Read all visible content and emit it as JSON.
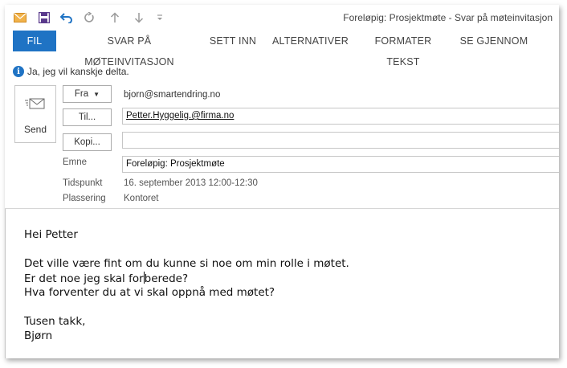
{
  "window": {
    "title": "Foreløpig: Prosjektmøte - Svar på møteinvitasjon"
  },
  "quick_access": {
    "icons": [
      "envelope-icon",
      "save-icon",
      "undo-icon",
      "redo-icon",
      "arrow-up-icon",
      "arrow-down-icon",
      "customize-icon"
    ]
  },
  "ribbon": {
    "tabs": [
      {
        "label": "FIL"
      },
      {
        "label": "SVAR PÅ MØTEINVITASJON"
      },
      {
        "label": "SETT INN"
      },
      {
        "label": "ALTERNATIVER"
      },
      {
        "label": "FORMATER TEKST"
      },
      {
        "label": "SE GJENNOM"
      }
    ]
  },
  "infobar": {
    "text": "Ja, jeg vil kanskje delta."
  },
  "compose": {
    "send_label": "Send",
    "from_button": "Fra",
    "from_address": "bjorn@smartendring.no",
    "to_button": "Til...",
    "to_value": "Petter.Hyggelig.@firma.no",
    "cc_button": "Kopi...",
    "cc_value": "",
    "subject_label": "Emne",
    "subject_value": "Foreløpig: Prosjektmøte",
    "time_label": "Tidspunkt",
    "time_value": "16. september 2013 12:00-12:30",
    "location_label": "Plassering",
    "location_value": "Kontoret"
  },
  "body": {
    "greeting": "Hei Petter",
    "line1": "Det ville være fint om du kunne si noe om min rolle i møtet.",
    "line2_before_cursor": "Er det noe jeg skal for",
    "line2_after_cursor": "berede?",
    "line3": "Hva forventer du at vi skal oppnå med møtet?",
    "closing": "Tusen takk,",
    "signature": "Bjørn"
  },
  "colors": {
    "accent": "#1f73c4",
    "envelope": "#e8a23a"
  }
}
